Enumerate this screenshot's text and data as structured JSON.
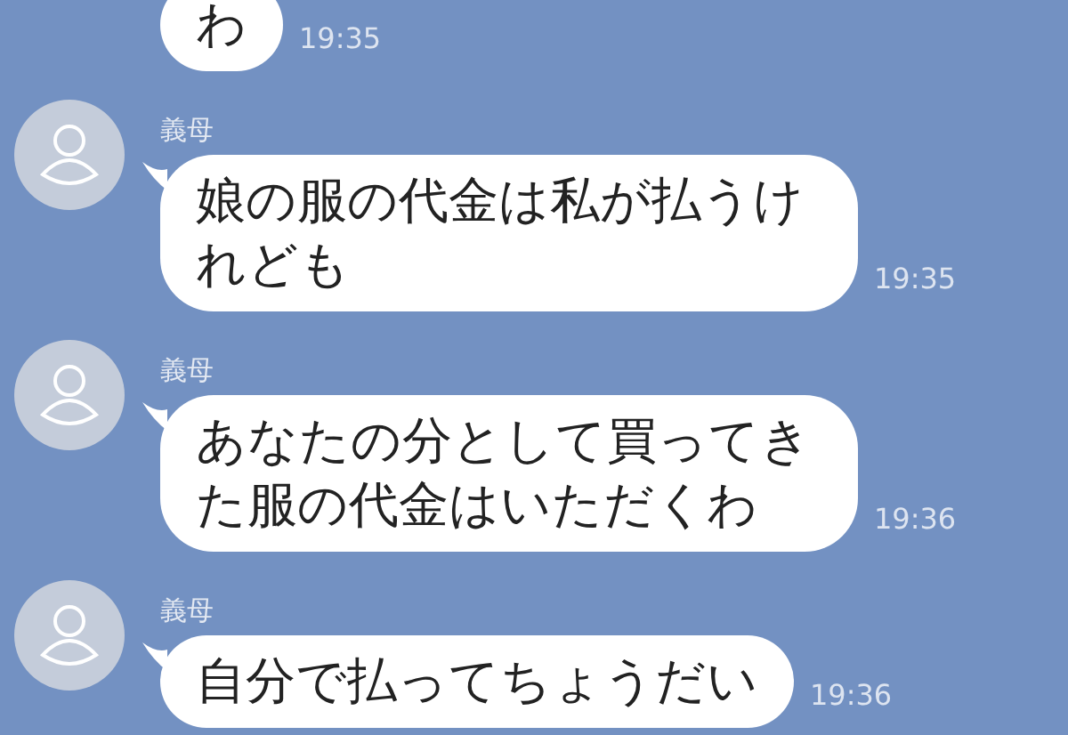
{
  "messages": [
    {
      "text": "わ",
      "time": "19:35"
    },
    {
      "sender": "義母",
      "text": "娘の服の代金は私が払うけれども",
      "time": "19:35"
    },
    {
      "sender": "義母",
      "text": "あなたの分として買ってきた服の代金はいただくわ",
      "time": "19:36"
    },
    {
      "sender": "義母",
      "text": "自分で払ってちょうだい",
      "time": "19:36"
    }
  ]
}
